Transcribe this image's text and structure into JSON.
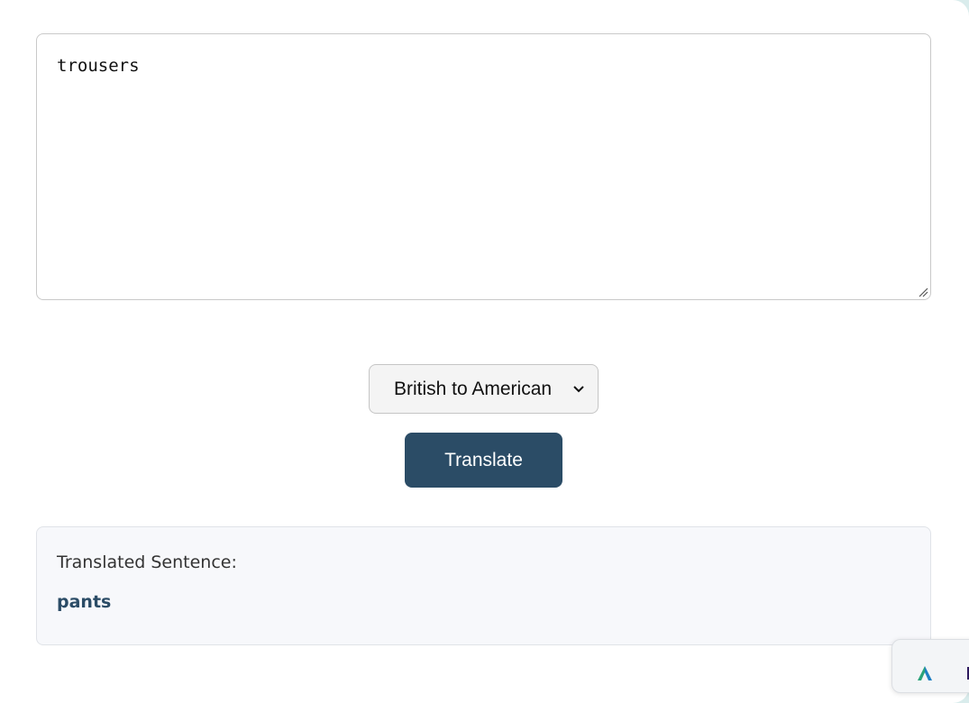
{
  "input": {
    "value": "trousers"
  },
  "direction_select": {
    "selected": "British to American"
  },
  "translate_button": {
    "label": "Translate"
  },
  "result": {
    "label": "Translated Sentence:",
    "text": "pants"
  },
  "colors": {
    "accent": "#2b4c66",
    "page_background": "#d9ecec",
    "result_background": "#f7f8fb"
  },
  "icons": {
    "select_arrow": "chevron-down-icon",
    "resize": "resize-handle-icon",
    "widget": "triangle-logo-icon"
  }
}
